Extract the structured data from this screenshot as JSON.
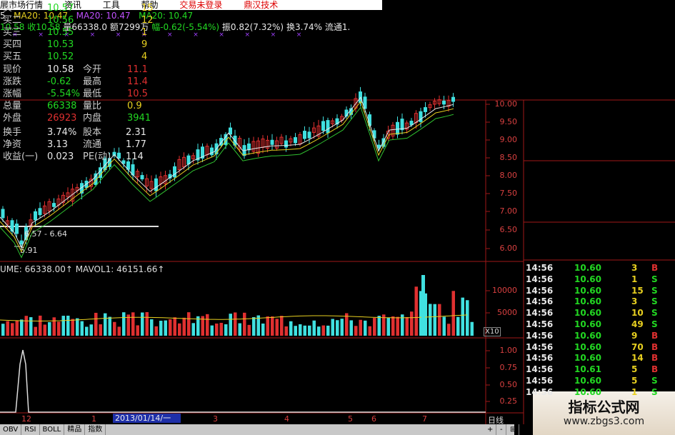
{
  "menubar": {
    "items": [
      "展市场行情",
      "资讯",
      "工具",
      "帮助"
    ],
    "login": "交易未登录",
    "tech": "鼎汉技术"
  },
  "ma_line": {
    "ma_prefix": "5",
    "ma_a": "MA20: 10.47",
    "ma_b": "MA20: 10.47",
    "ma_c": "MA20: 10.47"
  },
  "info_line": {
    "a": "10.58",
    "b": "收10.58",
    "c": "量66338.0",
    "d": "额7299万",
    "e": "幅-0.62(-5.54%)",
    "f": "振0.82(7.32%)",
    "g": "换3.74%",
    "h": "流通1."
  },
  "annotations": {
    "support_range": "6.57 - 6.64",
    "low_price": "5.91"
  },
  "price_axis": [
    "10.00",
    "9.50",
    "9.00",
    "8.50",
    "8.00",
    "7.50",
    "7.00",
    "6.50",
    "6.00"
  ],
  "volume": {
    "label": "UME: 66338.00↑  MAVOL1: 46151.66↑",
    "axis": [
      "10000",
      "5000"
    ],
    "multiplier": "X10"
  },
  "indicator_axis": [
    "1.00",
    "0.75",
    "0.50",
    "0.25"
  ],
  "xaxis": {
    "ticks": [
      "12",
      "1",
      "3",
      "4",
      "5",
      "6",
      "7"
    ],
    "date_box": "2013/01/14/一",
    "period": "日线"
  },
  "tabs": [
    "OBV",
    "RSI",
    "BOLL",
    "精品",
    "指数"
  ],
  "tab_nav": {
    "plus": "+",
    "minus": "-",
    "extra": "⊞"
  },
  "order_book": [
    {
      "label": "买一",
      "price": "10.57",
      "vol": "15"
    },
    {
      "label": "买二",
      "price": "10.56",
      "vol": "12"
    },
    {
      "label": "买三",
      "price": "10.55",
      "vol": "1"
    },
    {
      "label": "买四",
      "price": "10.53",
      "vol": "9"
    },
    {
      "label": "买五",
      "price": "10.52",
      "vol": "4"
    }
  ],
  "quote": [
    {
      "l1": "现价",
      "v1": "10.58",
      "l2": "今开",
      "v2": "11.1"
    },
    {
      "l1": "涨跌",
      "v1": "-0.62",
      "l2": "最高",
      "v2": "11.4"
    },
    {
      "l1": "涨幅",
      "v1": "-5.54%",
      "l2": "最低",
      "v2": "10.5"
    },
    {
      "l1": "总量",
      "v1": "66338",
      "l2": "量比",
      "v2": "0.9"
    },
    {
      "l1": "外盘",
      "v1": "26923",
      "l2": "内盘",
      "v2": "3941"
    }
  ],
  "fundamentals": [
    {
      "l1": "换手",
      "v1": "3.74%",
      "l2": "股本",
      "v2": "2.31"
    },
    {
      "l1": "净资",
      "v1": "3.13",
      "l2": "流通",
      "v2": "1.77"
    },
    {
      "l1": "收益(一)",
      "v1": "0.023",
      "l2": "PE(动)",
      "v2": "114"
    }
  ],
  "ticks": [
    {
      "time": "14:56",
      "price": "10.60",
      "vol": "3",
      "side": "B"
    },
    {
      "time": "14:56",
      "price": "10.60",
      "vol": "1",
      "side": "S"
    },
    {
      "time": "14:56",
      "price": "10.60",
      "vol": "15",
      "side": "S"
    },
    {
      "time": "14:56",
      "price": "10.60",
      "vol": "3",
      "side": "S"
    },
    {
      "time": "14:56",
      "price": "10.60",
      "vol": "10",
      "side": "S"
    },
    {
      "time": "14:56",
      "price": "10.60",
      "vol": "49",
      "side": "S"
    },
    {
      "time": "14:56",
      "price": "10.60",
      "vol": "9",
      "side": "B"
    },
    {
      "time": "14:56",
      "price": "10.60",
      "vol": "70",
      "side": "B"
    },
    {
      "time": "14:56",
      "price": "10.60",
      "vol": "14",
      "side": "B"
    },
    {
      "time": "14:56",
      "price": "10.61",
      "vol": "5",
      "side": "B"
    },
    {
      "time": "14:56",
      "price": "10.60",
      "vol": "5",
      "side": "S"
    },
    {
      "time": "14:56",
      "price": "10.60",
      "vol": "1",
      "side": "S"
    }
  ],
  "watermark": {
    "title": "指标公式网",
    "url": "www.zbgs3.com"
  },
  "colors": {
    "up": "#e03030",
    "down": "#40e0e0",
    "grid": "#a01818",
    "ma_white": "#e8e8e8",
    "ma_yellow": "#e8d020",
    "ma_green": "#30c030"
  }
}
